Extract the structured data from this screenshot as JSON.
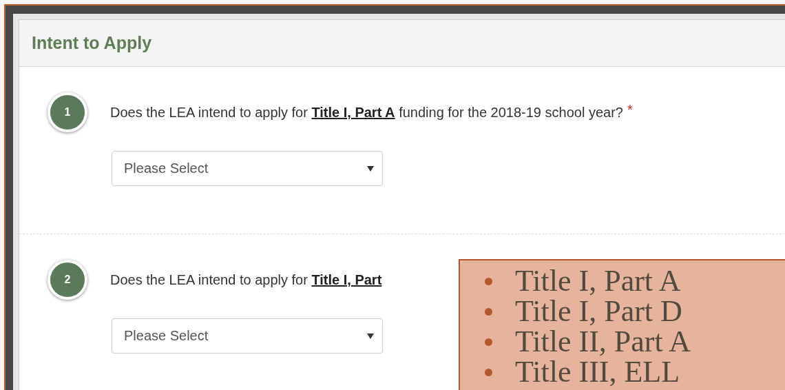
{
  "panel": {
    "title": "Intent to Apply"
  },
  "questions": [
    {
      "number": "1",
      "text": "Does the LEA intend to apply for **Title I, Part A** funding for the 2018-19 school year?",
      "required_mark": "*",
      "placeholder": "Please Select"
    },
    {
      "number": "2",
      "text": "Does the LEA intend to apply for **Title I, Part**",
      "placeholder": "Please Select"
    }
  ],
  "callout": {
    "items": [
      "Title I, Part A",
      "Title I, Part D",
      "Title II, Part A",
      "Title III, ELL"
    ]
  }
}
